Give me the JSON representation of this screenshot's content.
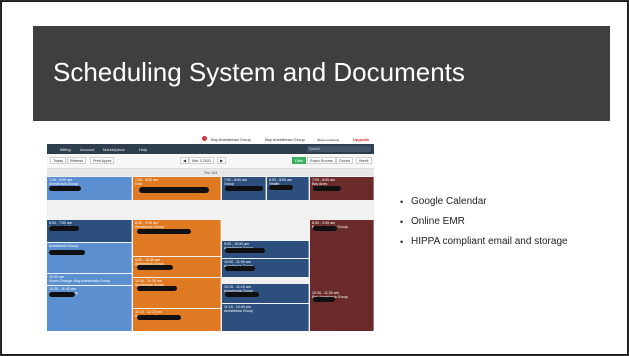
{
  "slide": {
    "title": "Scheduling System and Documents",
    "bullets": [
      "Google Calendar",
      "Online EMR",
      "HIPPA compliant email and storage"
    ]
  },
  "screenshot": {
    "top_bar": {
      "account": "Bay Anesthesia Group",
      "org": "Bay Anesthesia Group",
      "org_sub": "(BayAnesthesia)",
      "upgrade": "Upgrade"
    },
    "nav": {
      "items": [
        "Billing",
        "Account",
        "Marketplace",
        "Help"
      ],
      "search_placeholder": "Search"
    },
    "toolbar": {
      "today": "Today",
      "refresh": "Refresh",
      "print": "Print Appts",
      "date": "Mar 3 2022",
      "views": [
        "Date",
        "Exam Rooms",
        "Doctor",
        "Week"
      ]
    },
    "day_header": "Thu 3/3",
    "events": [
      {
        "time": "7:00 - 9:00 am",
        "text": "Anesthesia Group",
        "color": "blue"
      },
      {
        "time": "7:00 - 8:00 am",
        "text": "Oral",
        "color": "orange"
      },
      {
        "time": "7:00 - 8:00 am",
        "text": "Group",
        "color": "navy"
      },
      {
        "time": "6:00 - 8:00 am",
        "text": "Health",
        "color": "navy"
      },
      {
        "time": "7:00 - 8:00 am",
        "text": "Bay Anes",
        "color": "maroon"
      },
      {
        "time": "6:00 - 7:00 am",
        "text": "Anesthesia Group",
        "color": "navy"
      },
      {
        "time": "8:30 - 9:30 am",
        "text": "Anesthesia Group",
        "color": "orange"
      },
      {
        "time": "8:30 - 9:30 am",
        "text": "Bay Anesthesia Group",
        "color": "maroon"
      },
      {
        "time": "9:00 - 10:00 am",
        "text": "Anesthesia Group",
        "color": "navy"
      },
      {
        "time": "",
        "text": "Anesthesia Group",
        "color": "blue"
      },
      {
        "time": "9:30 - 10:30 am",
        "text": "Anesthesia Group",
        "color": "orange"
      },
      {
        "time": "10:00 - 11:00 am",
        "text": "Anesthesia Group",
        "color": "navy"
      },
      {
        "time": "10:30 am",
        "text": "Room Change: Bay Anesthesia Group",
        "color": "blue"
      },
      {
        "time": "10:30 - 11:00 am",
        "text": "Anesthesia Group",
        "color": "blue"
      },
      {
        "time": "10:30 - 11:30 am",
        "text": "Anesthesia Group",
        "color": "orange"
      },
      {
        "time": "10:15 - 11:15 am",
        "text": "Anesthesia Group",
        "color": "navy"
      },
      {
        "time": "10:30 - 11:30 am",
        "text": "Bay Anesthesia Group",
        "color": "maroon"
      },
      {
        "time": "11:15 - 12:00 pm",
        "text": "Anesthesia Group",
        "color": "navy"
      },
      {
        "time": "11:15 - 12:15 pm",
        "text": "Anesthesia Group",
        "color": "orange"
      }
    ]
  }
}
